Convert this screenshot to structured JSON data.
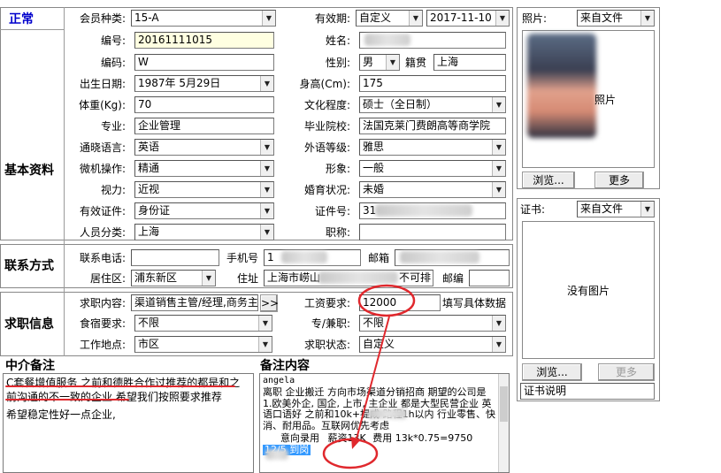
{
  "status": {
    "label": "正常"
  },
  "sections": {
    "basic": "基本资料",
    "contact": "联系方式",
    "job": "求职信息",
    "agent_note": "中介备注",
    "note_content": "备注内容"
  },
  "basic": {
    "member_type": {
      "label": "会员种类:",
      "value": "15-A"
    },
    "validity": {
      "label": "有效期:",
      "mode": "自定义",
      "date": "2017-11-10"
    },
    "serial": {
      "label": "编号:",
      "value": "20161111015"
    },
    "name": {
      "label": "姓名:",
      "value": ""
    },
    "code": {
      "label": "编码:",
      "value": "W"
    },
    "gender": {
      "label": "性别:",
      "value": "男"
    },
    "native": {
      "label": "籍贯",
      "value": "上海"
    },
    "birth": {
      "label": "出生日期:",
      "value": "1987年 5月29日"
    },
    "height": {
      "label": "身高(Cm):",
      "value": "175"
    },
    "weight": {
      "label": "体重(Kg):",
      "value": "70"
    },
    "education": {
      "label": "文化程度:",
      "value": "硕士（全日制）"
    },
    "major": {
      "label": "专业:",
      "value": "企业管理"
    },
    "school": {
      "label": "毕业院校:",
      "value": "法国克莱门费朗高等商学院"
    },
    "language": {
      "label": "通晓语言:",
      "value": "英语"
    },
    "foreign_level": {
      "label": "外语等级:",
      "value": "雅思"
    },
    "computer": {
      "label": "微机操作:",
      "value": "精通"
    },
    "image": {
      "label": "形象:",
      "value": "一般"
    },
    "vision": {
      "label": "视力:",
      "value": "近视"
    },
    "marital": {
      "label": "婚育状况:",
      "value": "未婚"
    },
    "id_type": {
      "label": "有效证件:",
      "value": "身份证"
    },
    "id_no": {
      "label": "证件号:",
      "value": "31"
    },
    "category": {
      "label": "人员分类:",
      "value": "上海"
    },
    "title": {
      "label": "职称:",
      "value": ""
    }
  },
  "contact": {
    "phone": {
      "label": "联系电话:",
      "value": ""
    },
    "mobile": {
      "label": "手机号",
      "value": "1"
    },
    "email": {
      "label": "邮箱",
      "value": ""
    },
    "district": {
      "label": "居住区:",
      "value": "浦东新区"
    },
    "address": {
      "label": "住址",
      "value": "上海市崂山",
      "tail": "不可排"
    },
    "postcode": {
      "label": "邮编",
      "value": ""
    }
  },
  "job": {
    "content": {
      "label": "求职内容:",
      "value": "渠道销售主管/经理,商务主",
      "more": ">>"
    },
    "salary": {
      "label": "工资要求:",
      "value": "12000",
      "hint": "填写具体数据"
    },
    "board": {
      "label": "食宿要求:",
      "value": "不限"
    },
    "parttime": {
      "label": "专/兼职:",
      "value": "不限"
    },
    "location": {
      "label": "工作地点:",
      "value": "市区"
    },
    "state": {
      "label": "求职状态:",
      "value": "自定义"
    }
  },
  "agent_note": {
    "line1": "C套餐增值服务 之前和德胜合作过推荐的都是和之前沟通的不一致的企业 希望我们按照要求推荐",
    "line2": "希望稳定性好一点企业,"
  },
  "note_content": {
    "name": "angela",
    "body": "离职 企业搬迁 方向市场渠道分销招商 期望的公司是 1.欧美外企, 国企, 上市, 主企业 都是大型民营企业 英语口语好 之前和10k+提成 路程1h以内 行业零售、快消、耐用品。互联网优先考虑",
    "intent": "意向录用",
    "salary_tag": "薪资13K",
    "fee": "费用 13k*0.75=9750",
    "selected": "12/5 到岗"
  },
  "photo": {
    "label": "照片:",
    "source": "来自文件",
    "caption": "照片",
    "browse": "浏览...",
    "more": "更多"
  },
  "cert": {
    "label": "证书:",
    "source": "来自文件",
    "empty": "没有图片",
    "browse": "浏览...",
    "more": "更多",
    "desc": "证书说明"
  },
  "colors": {
    "annotation": "#e0282d",
    "selection": "#3399ff",
    "status": "#0000cc"
  }
}
